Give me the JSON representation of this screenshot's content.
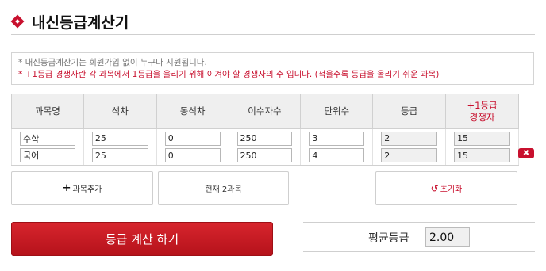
{
  "page": {
    "title": "내신등급계산기"
  },
  "notice": {
    "line1": "* 내신등급계산기는 회원가입 없이 누구나 지원됩니다.",
    "line2": "* +1등급 경쟁자란 각 과목에서 1등급을 올리기 위해 이겨야 할 경쟁자의 수 입니다. (적을수록 등급을 올리기 쉬운 과목)"
  },
  "table": {
    "headers": [
      "과목명",
      "석차",
      "동석차",
      "이수자수",
      "단위수",
      "등급"
    ],
    "competitor_header_line1": "+1등급",
    "competitor_header_line2": "경쟁자",
    "rows": [
      {
        "subject": "수학",
        "rank": "25",
        "tie": "0",
        "students": "250",
        "units": "3",
        "grade": "2",
        "competitors": "15"
      },
      {
        "subject": "국어",
        "rank": "25",
        "tie": "0",
        "students": "250",
        "units": "4",
        "grade": "2",
        "competitors": "15"
      }
    ]
  },
  "buttons": {
    "add_label": "과목추가",
    "count_label": "현재 2과목",
    "reset_label": "초기화",
    "calc_label": "등급 계산 하기",
    "delete_label": "✖"
  },
  "result": {
    "avg_label": "평균등급",
    "avg_value": "2.00"
  },
  "colors": {
    "accent": "#c8102e",
    "header_bg": "#efefef"
  }
}
